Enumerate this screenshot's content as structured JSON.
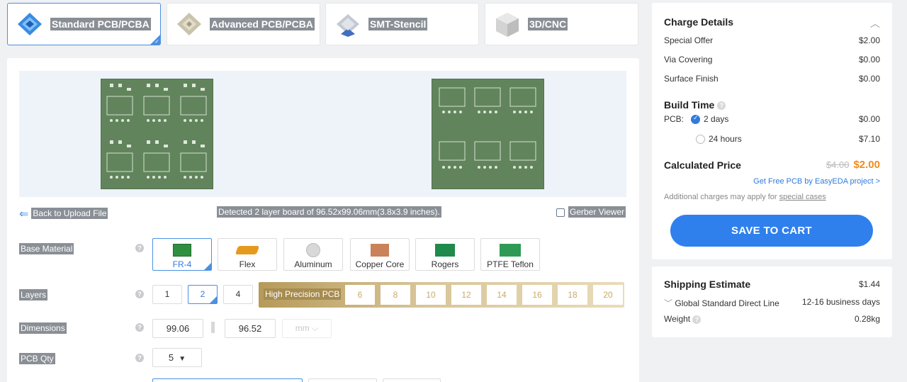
{
  "tabs": [
    {
      "label": "Standard PCB/PCBA",
      "active": true
    },
    {
      "label": "Advanced PCB/PCBA",
      "active": false
    },
    {
      "label": "SMT-Stencil",
      "active": false
    },
    {
      "label": "3D/CNC",
      "active": false
    }
  ],
  "preview": {
    "back_link": "Back to Upload File",
    "detected": "Detected 2 layer board of 96.52x99.06mm(3.8x3.9 inches).",
    "gerber_viewer": "Gerber Viewer"
  },
  "form": {
    "base_material_label": "Base Material",
    "materials": [
      "FR-4",
      "Flex",
      "Aluminum",
      "Copper Core",
      "Rogers",
      "PTFE Teflon"
    ],
    "layers_label": "Layers",
    "layers": [
      "1",
      "2",
      "4"
    ],
    "high_precision_label": "High Precision PCB",
    "high_precision_layers": [
      "6",
      "8",
      "10",
      "12",
      "14",
      "16",
      "18",
      "20"
    ],
    "dimensions_label": "Dimensions",
    "dim_x": "99.06",
    "dim_y": "96.52",
    "dim_unit": "mm",
    "qty_label": "PCB Qty",
    "qty_value": "5",
    "help_glyph": "?"
  },
  "charges": {
    "title": "Charge Details",
    "items": [
      {
        "label": "Special Offer",
        "value": "$2.00"
      },
      {
        "label": "Via Covering",
        "value": "$0.00"
      },
      {
        "label": "Surface Finish",
        "value": "$0.00"
      }
    ],
    "build_time_title": "Build Time",
    "pcb_label": "PCB:",
    "build_options": [
      {
        "label": "2 days",
        "value": "$0.00",
        "selected": true
      },
      {
        "label": "24 hours",
        "value": "$7.10",
        "selected": false
      }
    ],
    "calc_title": "Calculated Price",
    "old_price": "$4.00",
    "new_price": "$2.00",
    "free_pcb_link": "Get Free PCB by EasyEDA project >",
    "note_prefix": "Additional charges may apply for ",
    "note_link": "special cases",
    "cart_button": "SAVE TO CART"
  },
  "shipping": {
    "title": "Shipping Estimate",
    "price": "$1.44",
    "method": "Global Standard Direct Line",
    "days": "12-16 business days",
    "weight_label": "Weight",
    "weight_value": "0.28kg"
  },
  "colors": {
    "accent": "#2f80ed",
    "price_orange": "#f28a1e",
    "board_green": "#61845c",
    "gold": "#c9a96a"
  }
}
